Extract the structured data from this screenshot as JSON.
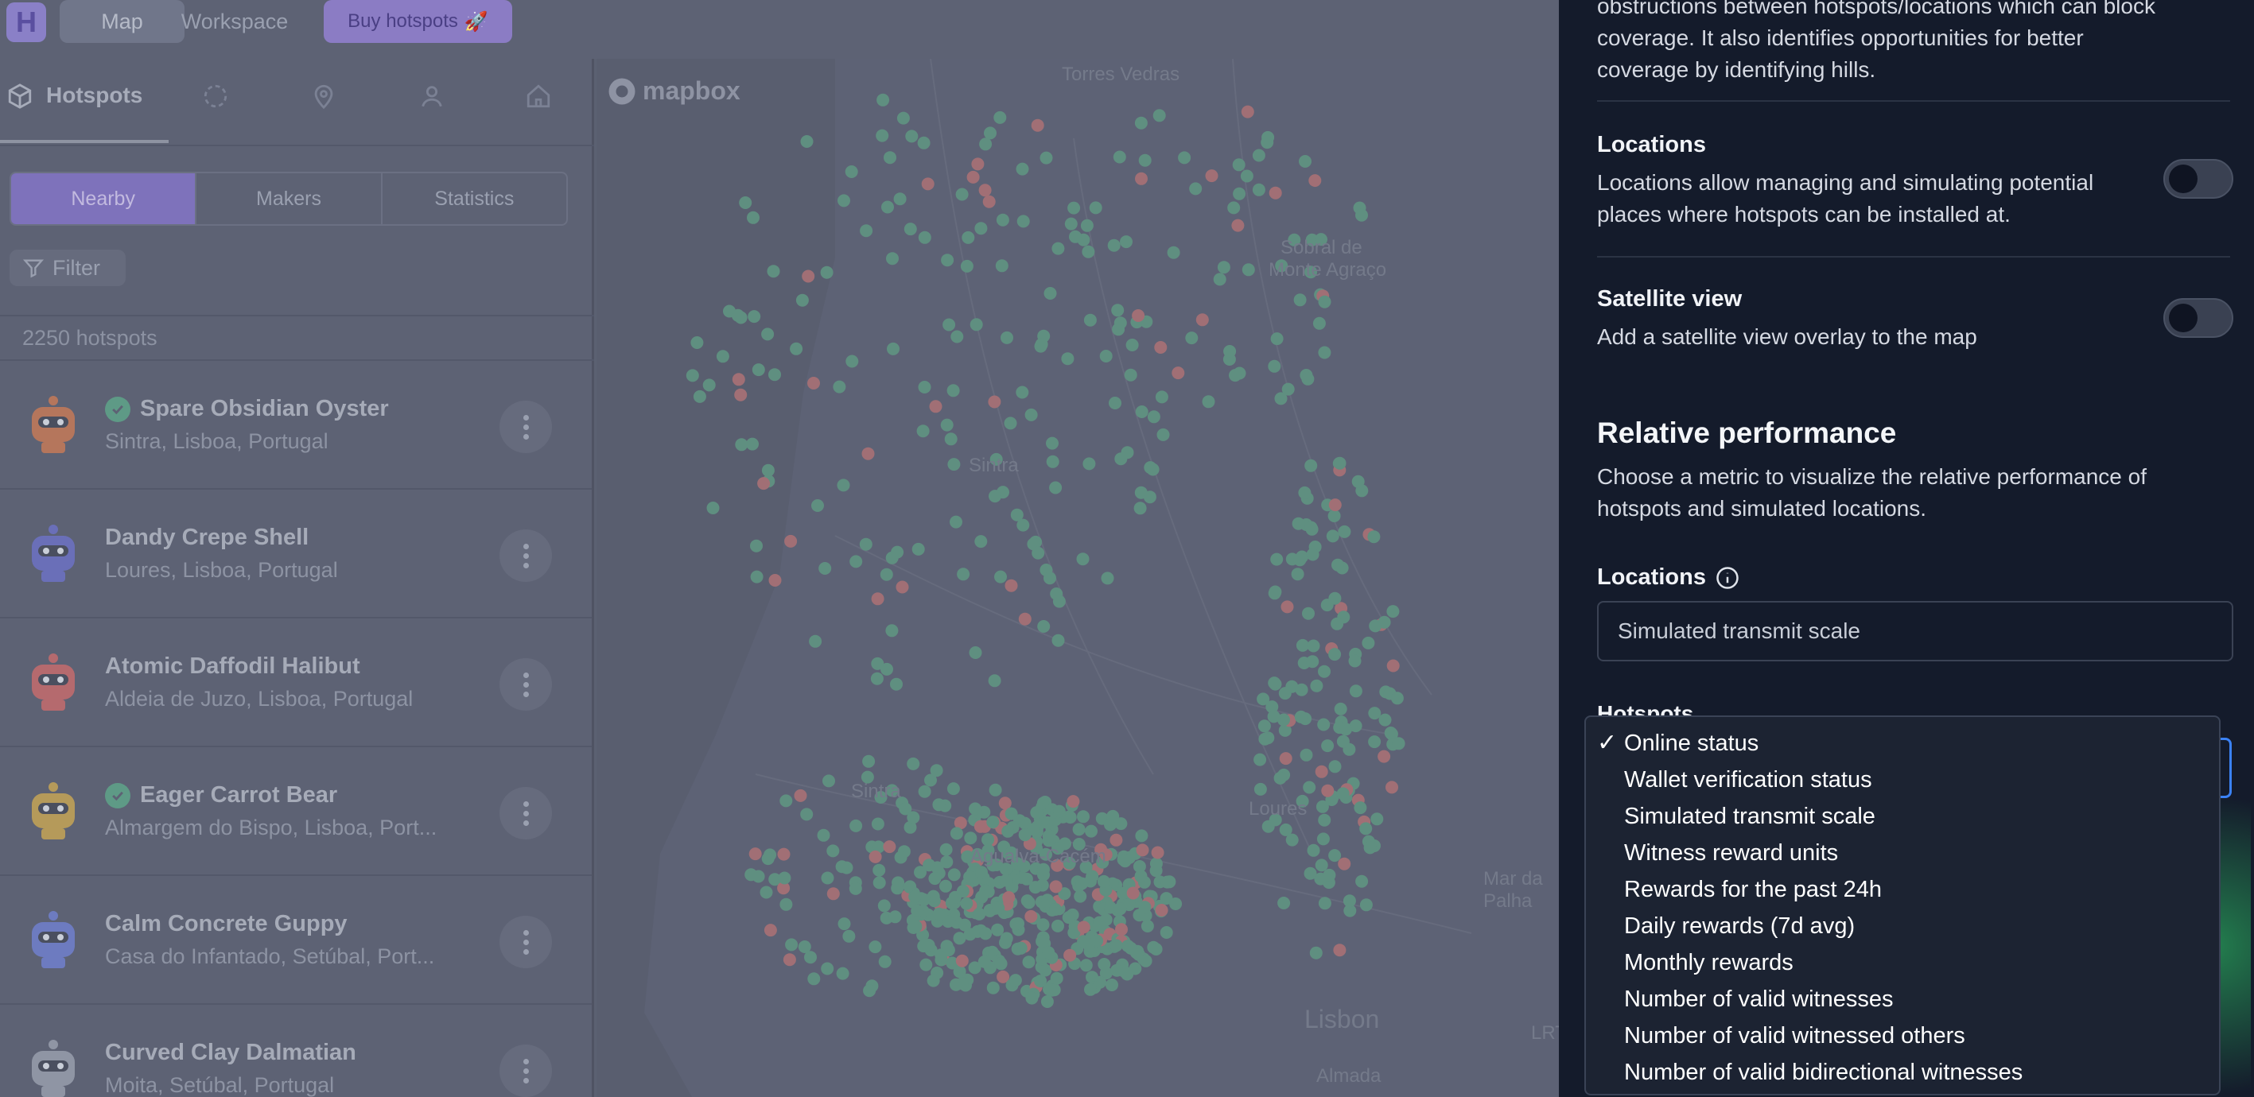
{
  "topbar": {
    "logo": "H",
    "tabs": [
      "Map",
      "Workspace"
    ],
    "buy_label": "Buy hotspots",
    "buy_emoji": "🚀"
  },
  "sidebar": {
    "nav_label": "Hotspots",
    "segments": [
      "Nearby",
      "Makers",
      "Statistics"
    ],
    "filter_label": "Filter",
    "count": "2250 hotspots",
    "hotspots": [
      {
        "name": "Spare Obsidian Oyster",
        "location": "Sintra, Lisboa, Portugal",
        "verified": true,
        "avatar_color": "#b5765c"
      },
      {
        "name": "Dandy Crepe Shell",
        "location": "Loures, Lisboa, Portugal",
        "verified": false,
        "avatar_color": "#6a6fb8"
      },
      {
        "name": "Atomic Daffodil Halibut",
        "location": "Aldeia de Juzo, Lisboa, Portugal",
        "verified": false,
        "avatar_color": "#b56a6e"
      },
      {
        "name": "Eager Carrot Bear",
        "location": "Almargem do Bispo, Lisboa, Port...",
        "verified": true,
        "avatar_color": "#b59a5a"
      },
      {
        "name": "Calm Concrete Guppy",
        "location": "Casa do Infantado, Setúbal, Port...",
        "verified": false,
        "avatar_color": "#6d7bc0"
      },
      {
        "name": "Curved Clay Dalmatian",
        "location": "Moita, Setúbal, Portugal",
        "verified": false,
        "avatar_color": "#8f95a4"
      }
    ]
  },
  "map": {
    "brand": "mapbox",
    "labels": [
      {
        "text": "Torres Vedras"
      },
      {
        "text": "Sobral de"
      },
      {
        "text": "Monte Agraço"
      },
      {
        "text": "Sintra"
      },
      {
        "text": "Sintra"
      },
      {
        "text": "Loures"
      },
      {
        "text": "Agualva-Cacém"
      },
      {
        "text": "Lisbon"
      },
      {
        "text": "Almada"
      },
      {
        "text": "Mar da Palha"
      },
      {
        "text": "LRT"
      }
    ]
  },
  "panel": {
    "intro_text": "obstructions between hotspots/locations which can block coverage. It also identifies opportunities for better coverage by identifying hills.",
    "locations_title": "Locations",
    "locations_text": "Locations allow managing and simulating potential places where hotspots can be installed at.",
    "satellite_title": "Satellite view",
    "satellite_text": "Add a satellite view overlay to the map",
    "relative_title": "Relative performance",
    "relative_text": "Choose a metric to visualize the relative performance of hotspots and simulated locations.",
    "locations_label": "Locations",
    "locations_value": "Simulated transmit scale",
    "hotspots_label": "Hotspots"
  },
  "dropdown": {
    "selected": "Online status",
    "options": [
      "Online status",
      "Wallet verification status",
      "Simulated transmit scale",
      "Witness reward units",
      "Rewards for the past 24h",
      "Daily rewards (7d avg)",
      "Monthly rewards",
      "Number of valid witnesses",
      "Number of valid witnessed others",
      "Number of valid bidirectional witnesses"
    ]
  },
  "colors": {
    "online_dot": "#5f8f80",
    "offline_dot": "#a16f75",
    "accent": "#7e72bb",
    "panel_bg": "#141b2b"
  }
}
